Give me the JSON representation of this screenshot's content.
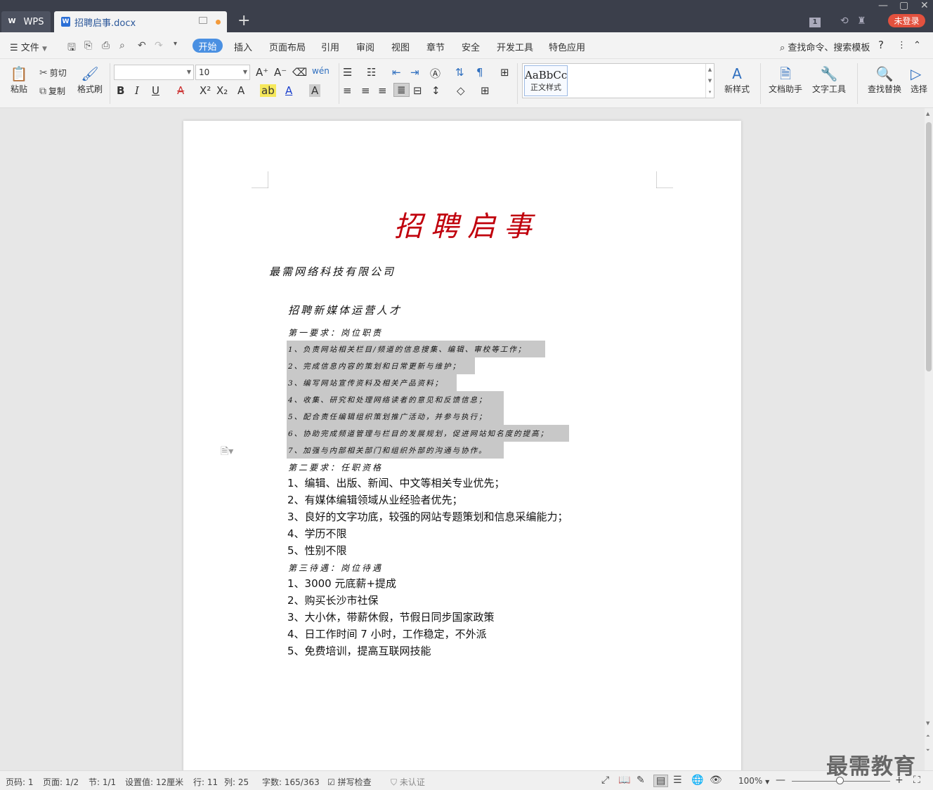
{
  "titlebar": {
    "app_tab": "WPS",
    "doc_tab": "招聘启事.docx",
    "new_tab": "+",
    "login": "未登录",
    "badge": "1"
  },
  "menubar": {
    "file": "文件",
    "tabs": [
      "开始",
      "插入",
      "页面布局",
      "引用",
      "审阅",
      "视图",
      "章节",
      "安全",
      "开发工具",
      "特色应用"
    ],
    "search": "查找命令、搜索模板",
    "help": "?"
  },
  "ribbon": {
    "paste": "粘贴",
    "cut": "剪切",
    "copy": "复制",
    "format_painter": "格式刷",
    "font_name": "",
    "font_size": "10",
    "style_sample": "AaBbCc",
    "style_name": "正文样式",
    "new_style": "新样式",
    "doc_helper": "文档助手",
    "text_tools": "文字工具",
    "find_replace": "查找替换",
    "select": "选择"
  },
  "document": {
    "title": "招聘启事",
    "company": "最需网络科技有限公司",
    "subtitle": "招聘新媒体运营人才",
    "section1": "第一要求：岗位职责",
    "duties": [
      "1、负责网站相关栏目/频道的信息搜集、编辑、审校等工作；",
      "2、完成信息内容的策划和日常更新与维护；",
      "3、编写网站宣传资料及相关产品资料；",
      "4、收集、研究和处理网络读者的意见和反馈信息；",
      "5、配合责任编辑组织策划推广活动，并参与执行；",
      "6、协助完成频道管理与栏目的发展规划，促进网站知名度的提高；",
      "7、加强与内部相关部门和组织外部的沟通与协作。"
    ],
    "section2": "第二要求：任职资格",
    "qualifications": [
      "1、编辑、出版、新闻、中文等相关专业优先；",
      "2、有媒体编辑领域从业经验者优先；",
      "3、良好的文字功底，较强的网站专题策划和信息采编能力；",
      "4、学历不限",
      "5、性别不限"
    ],
    "section3": "第三待遇：岗位待遇",
    "benefits": [
      "1、3000 元底薪+提成",
      "2、购买长沙市社保",
      "3、大小休，带薪休假，节假日同步国家政策",
      "4、日工作时间 7 小时，工作稳定，不外派",
      "5、免费培训，提高互联网技能"
    ]
  },
  "status": {
    "page_code": "页码: 1",
    "pages": "页面: 1/2",
    "section": "节: 1/1",
    "setting": "设置值: 12厘米",
    "row": "行: 11",
    "col": "列: 25",
    "word_count": "字数: 165/363",
    "spell_check": "拼写检查",
    "auth": "未认证",
    "zoom": "100%"
  },
  "watermark": "最需教育",
  "colors": {
    "title_red": "#c0000c",
    "titlebar_bg": "#3b3f4b",
    "accent_blue": "#4a90e2",
    "login_red": "#e3513e",
    "selection_gray": "#c8c8c8"
  }
}
